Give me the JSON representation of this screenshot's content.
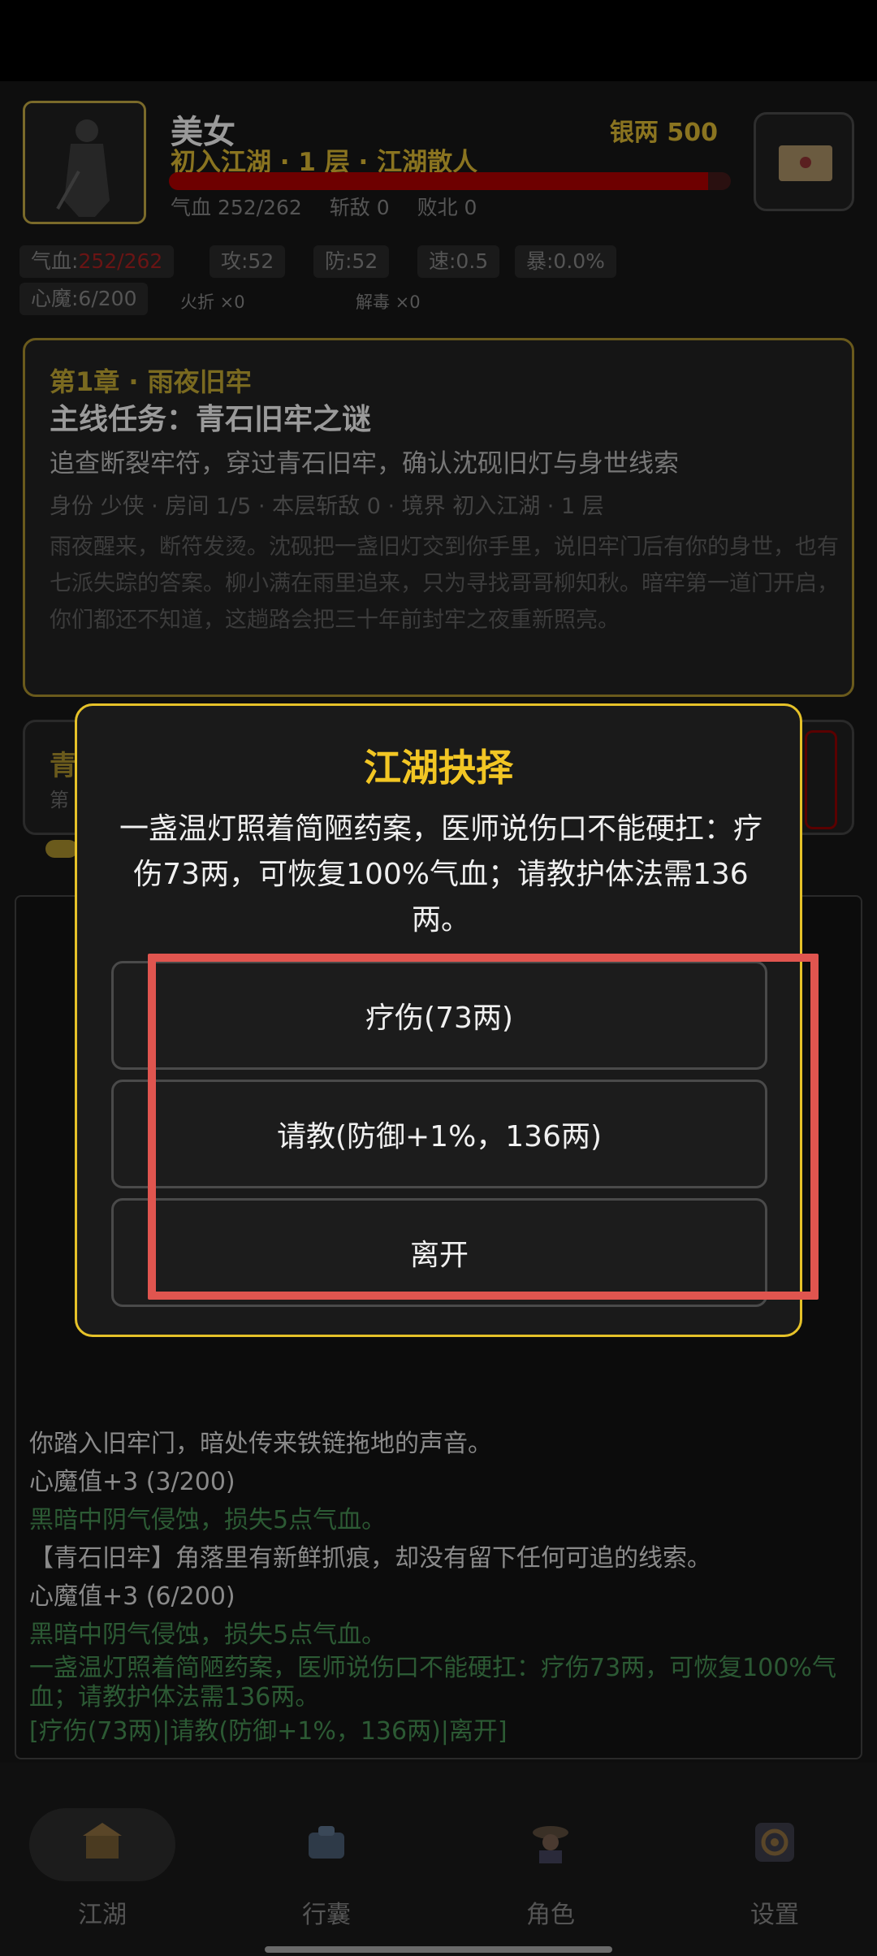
{
  "player": {
    "name": "美女",
    "rank": "初入江湖 · 1 层 · 江湖散人",
    "silver": "银两 500",
    "hp_fraction": 0.96,
    "stats_line": [
      "气血 252/262",
      "斩敌 0",
      "败北 0"
    ]
  },
  "attributes": {
    "hp_label": "气血:",
    "hp_value": "252/262",
    "attack": "攻:52",
    "defense": "防:52",
    "speed": "速:0.5",
    "crit": "暴:0.0%",
    "demon": "心魔:6/200",
    "tag_fire": "火折 ×0",
    "tag_antidote": "解毒 ×0"
  },
  "quest": {
    "chapter": "第1章 · 雨夜旧牢",
    "title": "主线任务：青石旧牢之谜",
    "goal": "追查断裂牢符，穿过青石旧牢，确认沈砚旧灯与身世线索",
    "meta": "身份 少侠 · 房间 1/5 · 本层斩敌 0 · 境界 初入江湖 · 1 层",
    "story": "雨夜醒来，断符发烫。沈砚把一盏旧灯交到你手里，说旧牢门后有你的身世，也有七派失踪的答案。柳小满在雨里追来，只为寻找哥哥柳知秋。暗牢第一道门开启，你们都还不知道，这趟路会把三十年前封牢之夜重新照亮。"
  },
  "card2": {
    "title": "青",
    "sub": "第"
  },
  "modal": {
    "title": "江湖抉择",
    "text": "一盏温灯照着简陋药案，医师说伤口不能硬扛：疗伤73两，可恢复100%气血；请教护体法需136两。",
    "options": [
      "疗伤(73两)",
      "请教(防御+1%，136两)",
      "离开"
    ]
  },
  "log": [
    {
      "text": "你踏入旧牢门，暗处传来铁链拖地的声音。",
      "color": "white"
    },
    {
      "text": "心魔值+3 (3/200)",
      "color": "white"
    },
    {
      "text": "黑暗中阴气侵蚀，损失5点气血。",
      "color": "green"
    },
    {
      "text": "【青石旧牢】角落里有新鲜抓痕，却没有留下任何可追的线索。",
      "color": "white"
    },
    {
      "text": "心魔值+3 (6/200)",
      "color": "white"
    },
    {
      "text": "黑暗中阴气侵蚀，损失5点气血。",
      "color": "green"
    },
    {
      "text": "一盏温灯照着简陋药案，医师说伤口不能硬扛：疗伤73两，可恢复100%气血；请教护体法需136两。",
      "color": "green"
    },
    {
      "text": "[疗伤(73两)|请教(防御+1%，136两)|离开]",
      "color": "green"
    }
  ],
  "nav": [
    {
      "label": "江湖",
      "icon": "jianghu-icon",
      "active": true
    },
    {
      "label": "行囊",
      "icon": "bag-icon",
      "active": false
    },
    {
      "label": "角色",
      "icon": "character-icon",
      "active": false
    },
    {
      "label": "设置",
      "icon": "settings-icon",
      "active": false
    }
  ],
  "colors": {
    "gold": "#f2c624",
    "highlight": "#e0554f",
    "hp_bar": "#6e0000"
  }
}
